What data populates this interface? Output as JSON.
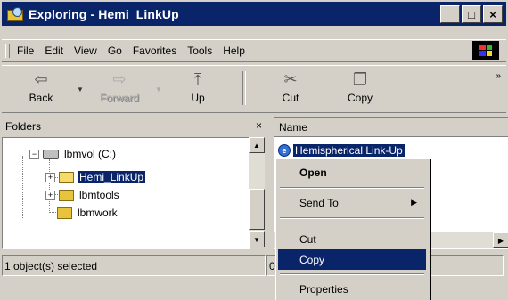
{
  "window": {
    "title": "Exploring - Hemi_LinkUp"
  },
  "titlebar_buttons": {
    "minimize": "_",
    "maximize": "□",
    "close": "×"
  },
  "menu": [
    "File",
    "Edit",
    "View",
    "Go",
    "Favorites",
    "Tools",
    "Help"
  ],
  "toolbar": {
    "back": "Back",
    "forward": "Forward",
    "up": "Up",
    "cut": "Cut",
    "copy": "Copy",
    "more": "»"
  },
  "folders": {
    "title": "Folders",
    "close_glyph": "×",
    "tree": [
      {
        "label": "lbmvol (C:)"
      },
      {
        "label": "Hemi_LinkUp"
      },
      {
        "label": "lbmtools"
      },
      {
        "label": "lbmwork"
      }
    ]
  },
  "list": {
    "column_name": "Name",
    "items": [
      {
        "label": "Hemispherical Link-Up"
      }
    ]
  },
  "status": {
    "left": "1 object(s) selected",
    "right": "0"
  },
  "context_menu": {
    "open": "Open",
    "send_to": "Send To",
    "cut": "Cut",
    "copy": "Copy",
    "properties": "Properties"
  }
}
